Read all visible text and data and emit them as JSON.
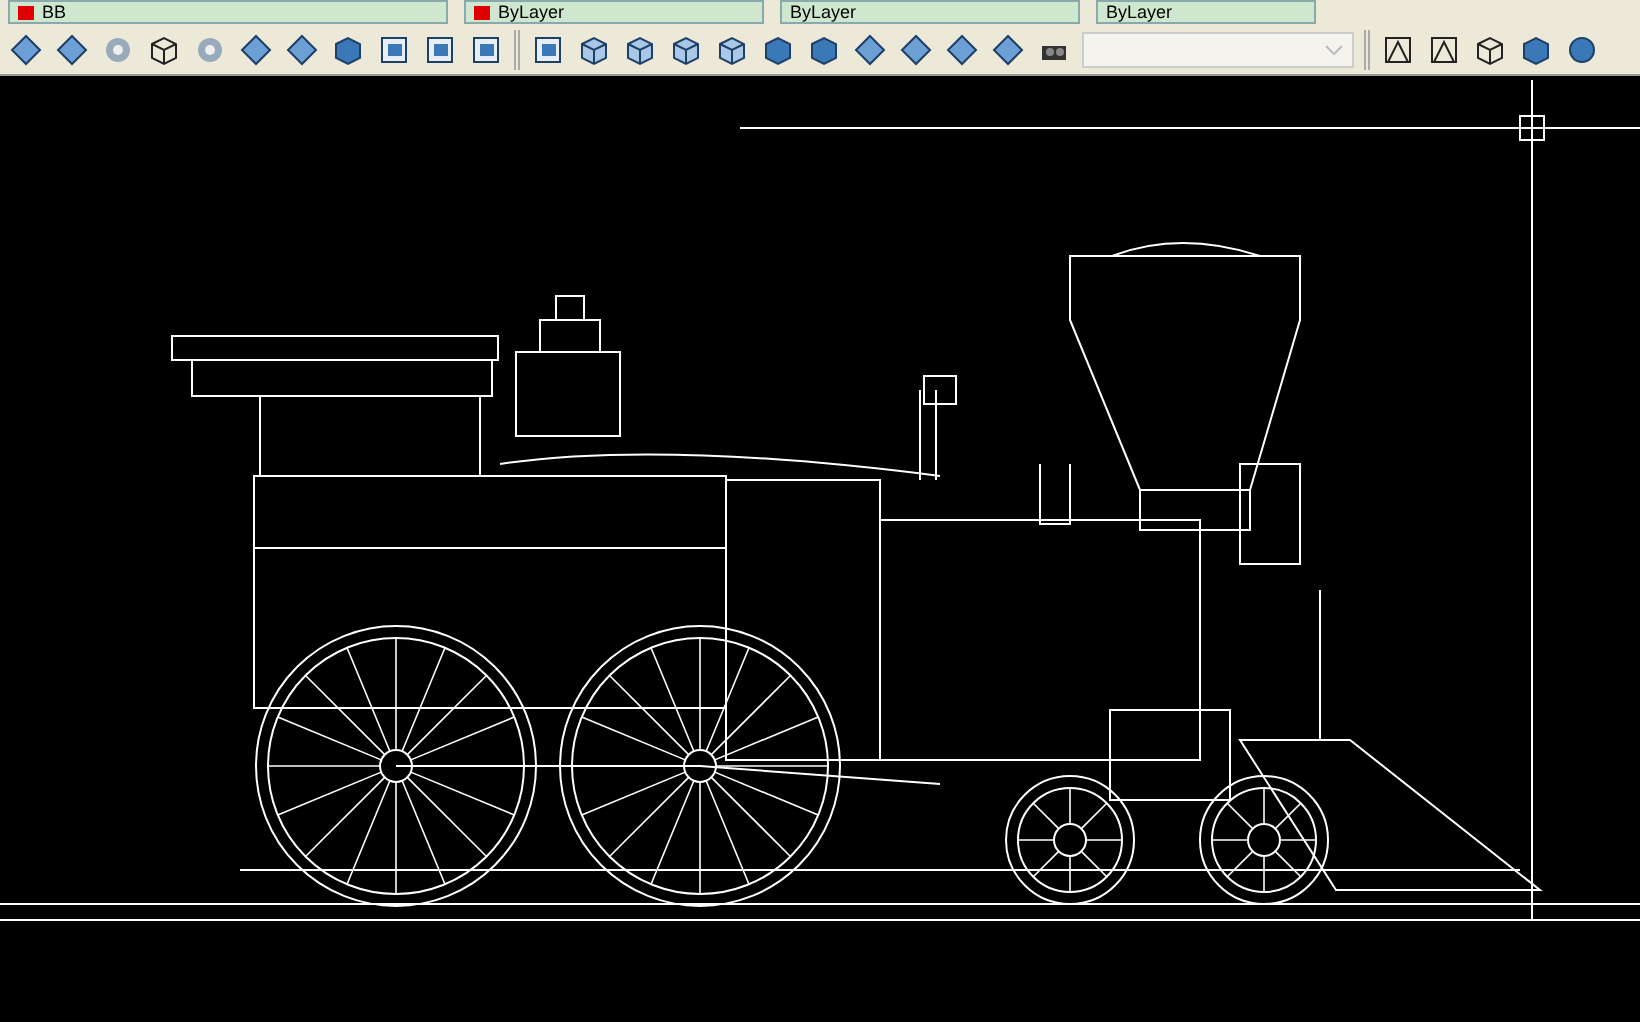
{
  "properties_bar": {
    "layer": "BB",
    "color_control": "ByLayer",
    "linetype": "ByLayer",
    "lineweight": "ByLayer"
  }
}
